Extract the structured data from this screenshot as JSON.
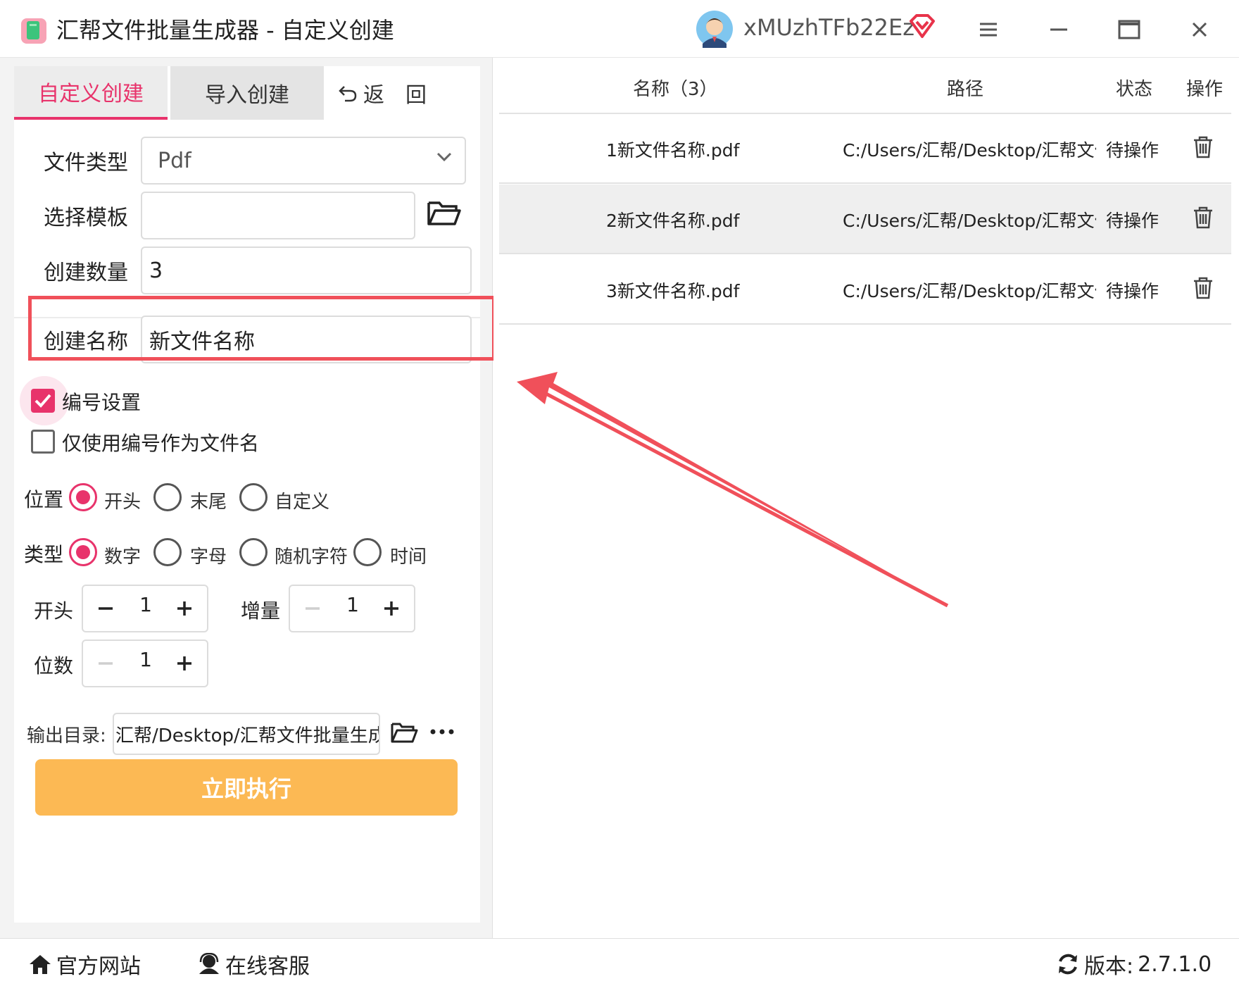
{
  "app": {
    "title": "汇帮文件批量生成器 - 自定义创建",
    "username": "xMUzhTFb22Ez"
  },
  "tabs": {
    "custom": "自定义创建",
    "import": "导入创建",
    "back": "返　回"
  },
  "form": {
    "file_type_label": "文件类型",
    "file_type_value": "Pdf",
    "template_label": "选择模板",
    "template_value": "",
    "count_label": "创建数量",
    "count_value": "3",
    "name_label": "创建名称",
    "name_value": "新文件名称",
    "numbering_label": "编号设置",
    "numbering_checked": true,
    "only_number_label": "仅使用编号作为文件名",
    "only_number_checked": false,
    "position_label": "位置",
    "position_options": [
      "开头",
      "末尾",
      "自定义"
    ],
    "position_selected": "开头",
    "type_label": "类型",
    "type_options": [
      "数字",
      "字母",
      "随机字符",
      "时间"
    ],
    "type_selected": "数字",
    "start_label": "开头",
    "start_value": "1",
    "increment_label": "增量",
    "increment_value": "1",
    "digits_label": "位数",
    "digits_value": "1",
    "output_label": "输出目录:",
    "output_value": "汇帮/Desktop/汇帮文件批量生成器",
    "run_label": "立即执行"
  },
  "table": {
    "headers": {
      "name": "名称（3）",
      "path": "路径",
      "status": "状态",
      "action": "操作"
    },
    "rows": [
      {
        "name": "1新文件名称.pdf",
        "path": "C:/Users/汇帮/Desktop/汇帮文件",
        "status": "待操作"
      },
      {
        "name": "2新文件名称.pdf",
        "path": "C:/Users/汇帮/Desktop/汇帮文件",
        "status": "待操作"
      },
      {
        "name": "3新文件名称.pdf",
        "path": "C:/Users/汇帮/Desktop/汇帮文件",
        "status": "待操作"
      }
    ]
  },
  "footer": {
    "site": "官方网站",
    "service": "在线客服",
    "version_label": "版本:",
    "version": "2.7.1.0"
  },
  "colors": {
    "accent": "#e8336b",
    "run_button": "#fcb954",
    "highlight": "#f0505a"
  },
  "icons": [
    "app-icon",
    "avatar",
    "vip-diamond-icon",
    "menu-icon",
    "minimize-icon",
    "maximize-icon",
    "close-icon",
    "back-icon",
    "chevron-down-icon",
    "folder-icon",
    "more-icon",
    "minus-icon",
    "plus-icon",
    "trash-icon",
    "home-icon",
    "support-icon",
    "refresh-icon"
  ]
}
